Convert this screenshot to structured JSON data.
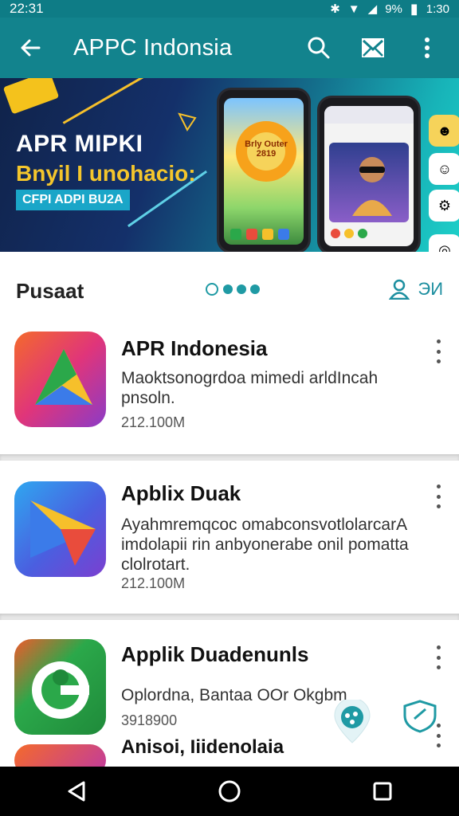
{
  "status_bar": {
    "time_left": "22:31",
    "battery_pct": "9%",
    "time_right": "1:30"
  },
  "app_bar": {
    "title": "APPC Indonsia"
  },
  "banner": {
    "headline": "APR MIPKI",
    "subheadline": "Bnyil I unohacio:",
    "chip": "CFPI ADPI BU2A",
    "phone_center_text": "Brly Outer 2819"
  },
  "section": {
    "label": "Pusaat",
    "account_label": "ЭИ"
  },
  "apps": [
    {
      "name": "APR Indonesia",
      "description": "Maoktsonogrdoa mimedi arldIncah pnsoln.",
      "size": "212.100M"
    },
    {
      "name": "Apblix Duak",
      "description": "Ayahmremqcoc omabconsvotlolarcarA imdolapii rin anbyonerabe onil pomatta clolrotart.",
      "size": "212.100M"
    },
    {
      "name": "Applik Duadenunls",
      "description": "Oplordna, Bantaa OOr Okgbm",
      "size": "3918900"
    },
    {
      "name": "Anisoi, Iiidenolaia"
    }
  ],
  "colors": {
    "app_bar": "#12838d",
    "status_bar": "#0e7c86",
    "accent": "#1f9aa4"
  }
}
